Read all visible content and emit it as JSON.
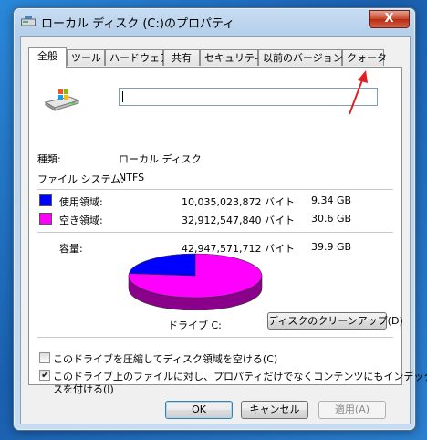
{
  "window": {
    "title": "ローカル ディスク (C:)のプロパティ",
    "close_label": "X"
  },
  "tabs": [
    {
      "label": "全般",
      "active": true
    },
    {
      "label": "ツール"
    },
    {
      "label": "ハードウェア"
    },
    {
      "label": "共有"
    },
    {
      "label": "セキュリティ"
    },
    {
      "label": "以前のバージョン"
    },
    {
      "label": "クォータ"
    }
  ],
  "general": {
    "name_value": "",
    "type_label": "種類:",
    "type_value": "ローカル ディスク",
    "fs_label": "ファイル システム:",
    "fs_value": "NTFS",
    "used_label": "使用領域:",
    "used_bytes": "10,035,023,872 バイト",
    "used_gb": "9.34 GB",
    "free_label": "空き領域:",
    "free_bytes": "32,912,547,840 バイト",
    "free_gb": "30.6 GB",
    "capacity_label": "容量:",
    "capacity_bytes": "42,947,571,712 バイト",
    "capacity_gb": "39.9 GB",
    "drive_label": "ドライブ C:",
    "cleanup_button": "ディスクのクリーンアップ(D)",
    "compress_label": "このドライブを圧縮してディスク領域を空ける(C)",
    "compress_checked": false,
    "index_label_line1": "このドライブ上のファイルに対し、プロパティだけでなくコンテンツにもインデック",
    "index_label_line2": "スを付ける(I)",
    "index_checked": true
  },
  "colors": {
    "used": "#0000ff",
    "free": "#ff00ff",
    "used_side": "#00008b",
    "free_side": "#8b008b",
    "annotation_arrow": "#e02020"
  },
  "chart_data": {
    "type": "pie",
    "categories": [
      "使用領域",
      "空き領域"
    ],
    "values": [
      9.34,
      30.6
    ],
    "title": "",
    "unit": "GB"
  },
  "buttons": {
    "ok": "OK",
    "cancel": "キャンセル",
    "apply": "適用(A)"
  }
}
